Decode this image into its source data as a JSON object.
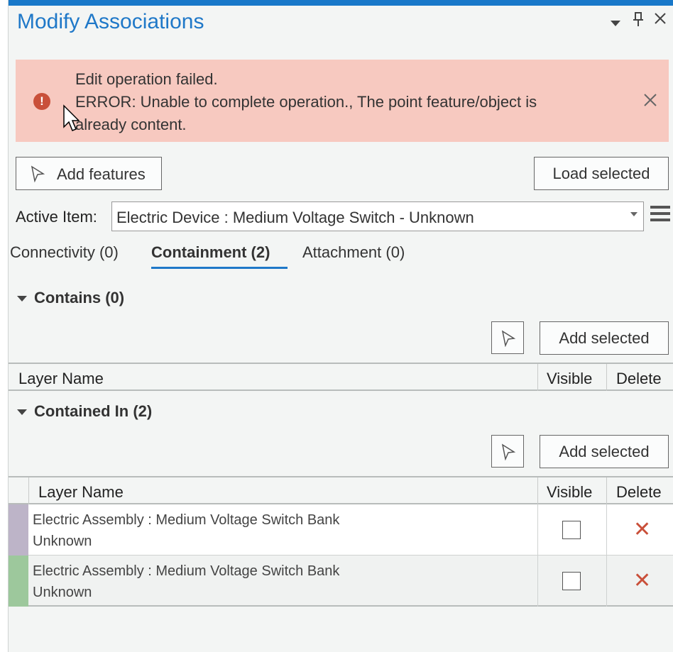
{
  "panel": {
    "title": "Modify Associations",
    "header_icons": {
      "dropdown": "chevron-down-icon",
      "pin": "pin-icon",
      "close": "close-icon"
    }
  },
  "error": {
    "line1": "Edit operation failed.",
    "line2": "ERROR: Unable to complete operation., The point feature/object is",
    "line3": "already content.",
    "icon": "error-icon",
    "close_icon": "close-icon"
  },
  "toolbar": {
    "add_features_label": "Add features",
    "load_selected_label": "Load selected"
  },
  "active_item": {
    "label": "Active Item:",
    "value": "Electric Device : Medium Voltage Switch - Unknown"
  },
  "tabs": [
    {
      "label": "Connectivity (0)"
    },
    {
      "label": "Containment (2)"
    },
    {
      "label": "Attachment (0)"
    }
  ],
  "contains": {
    "title": "Contains (0)",
    "add_selected_label": "Add selected",
    "columns": [
      "Layer Name",
      "Visible",
      "Delete"
    ]
  },
  "contained_in": {
    "title": "Contained In (2)",
    "add_selected_label": "Add selected",
    "columns": [
      "Layer Name",
      "Visible",
      "Delete"
    ],
    "rows": [
      {
        "name": "Electric Assembly : Medium Voltage Switch Bank",
        "sub": "Unknown",
        "color": "#bdb4c8",
        "visible": false
      },
      {
        "name": "Electric Assembly : Medium Voltage Switch Bank",
        "sub": "Unknown",
        "color": "#9dc89c",
        "visible": false
      }
    ]
  },
  "colors": {
    "accent": "#1f78c8",
    "error_bg": "#f7c9c0",
    "error_icon": "#c9503a"
  }
}
